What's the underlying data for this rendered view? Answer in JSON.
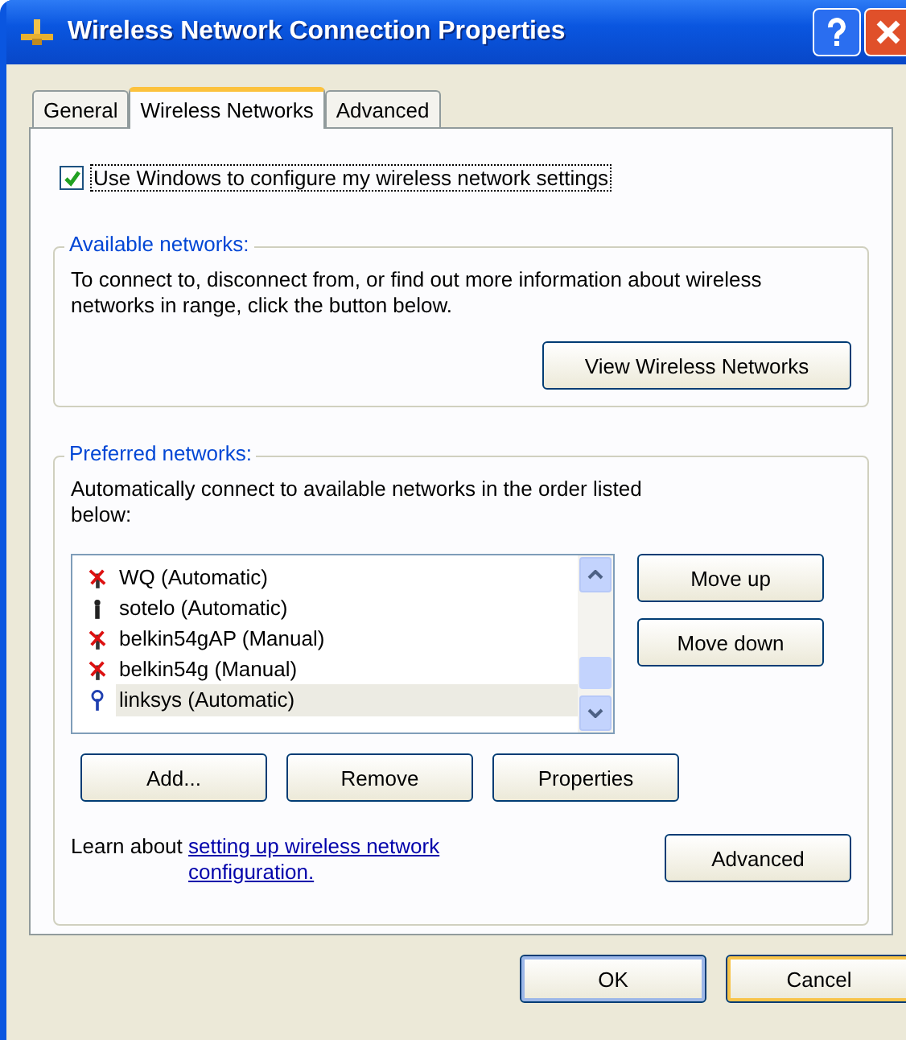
{
  "window": {
    "title": "Wireless Network Connection Properties"
  },
  "tabs": [
    {
      "label": "General",
      "selected": false
    },
    {
      "label": "Wireless Networks",
      "selected": true
    },
    {
      "label": "Advanced",
      "selected": false
    }
  ],
  "use_windows": {
    "label": "Use Windows to configure my wireless network settings",
    "checked": true
  },
  "available": {
    "legend": "Available networks:",
    "text": "To connect to, disconnect from, or find out more information about wireless networks in range, click the button below.",
    "button": "View Wireless Networks"
  },
  "preferred": {
    "legend": "Preferred networks:",
    "text": "Automatically connect to available networks in the order listed below:",
    "networks": [
      {
        "name": "WQ (Automatic)",
        "kind": "unavailable",
        "selected": false
      },
      {
        "name": "sotelo (Automatic)",
        "kind": "plain",
        "selected": false
      },
      {
        "name": "belkin54gAP (Manual)",
        "kind": "unavailable",
        "selected": false
      },
      {
        "name": "belkin54g (Manual)",
        "kind": "unavailable",
        "selected": false
      },
      {
        "name": "linksys (Automatic)",
        "kind": "available",
        "selected": true
      }
    ],
    "side_buttons": [
      "Move up",
      "Move down"
    ],
    "buttons": [
      "Add...",
      "Remove",
      "Properties"
    ],
    "learn_text": "Learn about",
    "learn_link": "setting up wireless network configuration.",
    "advanced_button": "Advanced"
  },
  "footer_buttons": [
    "OK",
    "Cancel"
  ]
}
